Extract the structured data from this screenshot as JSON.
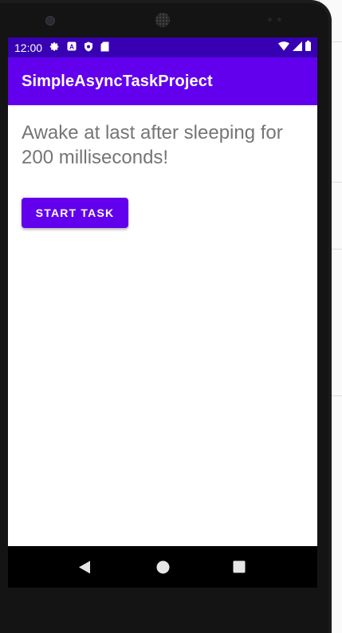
{
  "status_bar": {
    "time": "12:00",
    "left_icons": [
      "gear-icon",
      "a-notification-icon",
      "shield-icon",
      "sd-card-icon"
    ],
    "right_icons": [
      "wifi-icon",
      "signal-icon",
      "battery-icon"
    ]
  },
  "app_bar": {
    "title": "SimpleAsyncTaskProject"
  },
  "main": {
    "message": "Awake at last after sleeping for 200 milliseconds!",
    "start_button_label": "START TASK"
  },
  "nav_bar": {
    "buttons": [
      "back-icon",
      "home-icon",
      "recents-icon"
    ]
  },
  "colors": {
    "primary": "#6200EE",
    "primary_dark": "#3700B3",
    "text_secondary": "#757575"
  }
}
